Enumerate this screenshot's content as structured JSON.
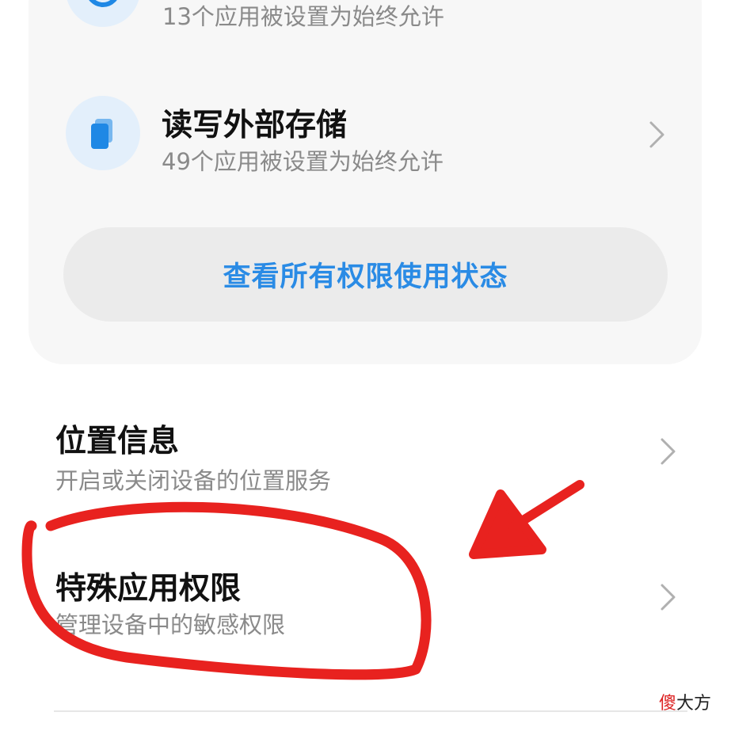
{
  "permissions": [
    {
      "icon": "clock-icon",
      "subtitle": "13个应用被设置为始终允许"
    },
    {
      "icon": "storage-files-icon",
      "title": "读写外部存储",
      "subtitle": "49个应用被设置为始终允许"
    }
  ],
  "view_all_button": "查看所有权限使用状态",
  "sections": [
    {
      "title": "位置信息",
      "subtitle": "开启或关闭设备的位置服务"
    },
    {
      "title": "特殊应用权限",
      "subtitle": "管理设备中的敏感权限"
    }
  ],
  "watermark": {
    "first": "傻",
    "rest": "大方"
  },
  "colors": {
    "accent": "#2a8be5",
    "icon_bg": "#e3effb",
    "annotation": "#e8221f"
  }
}
